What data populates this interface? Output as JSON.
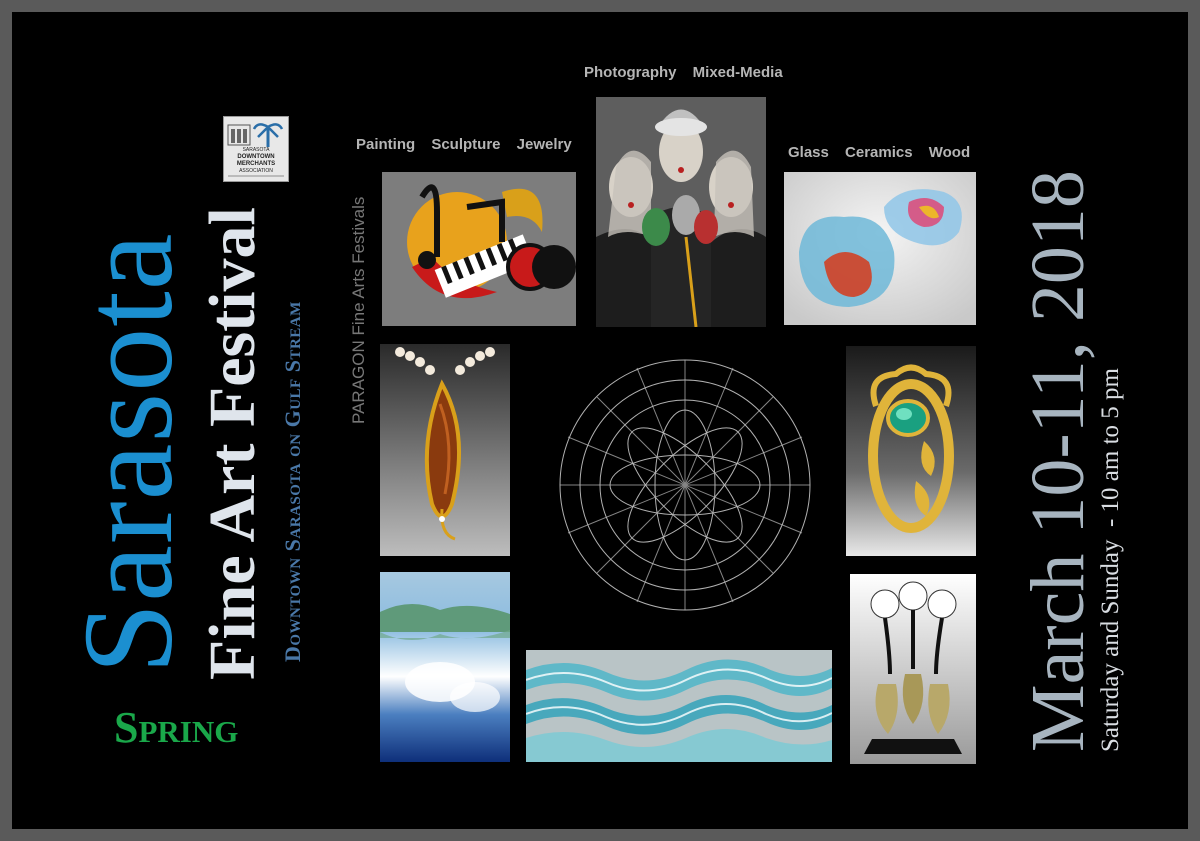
{
  "title": "Sarasota",
  "subtitle": "Fine Art Festival",
  "location": "Downtown Sarasota on Gulf Stream",
  "season": "Spring",
  "organizer": "PARAGON Fine Arts Festivals",
  "date": "March 10-11, 2018",
  "hours": "Saturday and Sunday  - 10 am to 5 pm",
  "categories": {
    "group1": "Painting Sculpture Jewelry",
    "group2": "Photography Mixed-Media",
    "group3": "Glass Ceramics Wood"
  },
  "logo": {
    "line1": "SARASOTA",
    "line2": "DOWNTOWN",
    "line3": "MERCHANTS",
    "line4": "ASSOCIATION"
  },
  "colors": {
    "title": "#1b8fd0",
    "spring": "#1aa84a",
    "date": "#a7b4bf",
    "background": "#000000",
    "border": "#5a5a5a"
  }
}
